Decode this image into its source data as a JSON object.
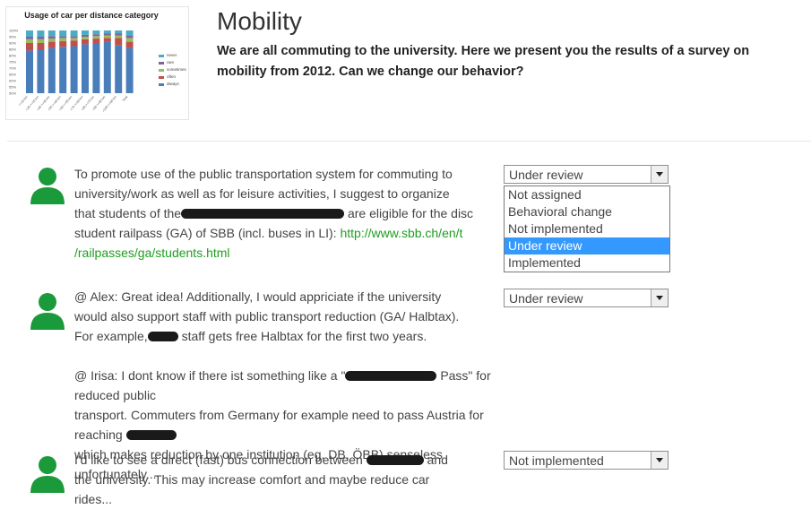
{
  "thumbnail": {
    "title": "Usage of car per distance category",
    "chart_data": {
      "type": "bar",
      "stacked": true,
      "title": "Usage of car per distance category",
      "y_ticks": [
        "100%",
        "95%",
        "90%",
        "85%",
        "80%",
        "75%",
        "70%",
        "65%",
        "60%",
        "55%",
        "50%"
      ],
      "categories": [
        "<=10 km",
        "<30 >=10 km",
        "<40 >=30 km",
        "<50 >=40 km",
        "<60 >=50 km",
        "<70 >=60 km",
        "<80 >=70 km",
        "<90 >=80 km",
        "<100 >=90 km",
        "Total"
      ],
      "series": [
        {
          "name": "always",
          "color": "#4a7ebb",
          "values": [
            68,
            70,
            72,
            74,
            75,
            78,
            80,
            82,
            76,
            72
          ]
        },
        {
          "name": "often",
          "color": "#c0504d",
          "values": [
            12,
            10,
            10,
            9,
            9,
            8,
            7,
            6,
            12,
            10
          ]
        },
        {
          "name": "sometimes",
          "color": "#9bbb59",
          "values": [
            6,
            6,
            5,
            5,
            4,
            4,
            4,
            4,
            4,
            6
          ]
        },
        {
          "name": "rare",
          "color": "#8064a2",
          "values": [
            4,
            4,
            4,
            3,
            3,
            3,
            3,
            3,
            3,
            4
          ]
        },
        {
          "name": "never",
          "color": "#4bacc6",
          "values": [
            10,
            10,
            9,
            9,
            9,
            7,
            6,
            5,
            5,
            8
          ]
        }
      ],
      "legend": [
        "never",
        "rare",
        "sometimes",
        "often",
        "always"
      ],
      "ylim": [
        50,
        100
      ]
    }
  },
  "header": {
    "title": "Mobility",
    "intro_line1": "We are all commuting to the university. Here we present you the results of a survey on",
    "intro_line2": "mobility from 2012. Can we change our behavior?"
  },
  "comments": [
    {
      "line1": "To promote use of the public transportation system for commuting to",
      "line2": "university/work as well as for leisure activities, I suggest to organize",
      "line3_a": "that students of the",
      "line3_b": "are eligible for the disc",
      "line4_a": "student railpass (GA) of SBB (incl. buses in LI):",
      "link_part1": "http://www.sbb.ch/en/t",
      "link_part2": "/railpasses/ga/students.html",
      "status": "Under review"
    },
    {
      "line1": "@ Alex: Great idea! Additionally, I would appriciate if the university",
      "line2": "would also support staff with public transport reduction (GA/ Halbtax).",
      "line3_a": "For example,",
      "line3_b": "staff gets free Halbtax for the first two years.",
      "line4_a": "@ Irisa: I dont know if there ist something like a \"",
      "line4_b": "Pass\" for reduced public",
      "line5": "transport. Commuters from Germany for example need to pass Austria for reaching",
      "line6": "which makes reduction by one institution (eg. DB, ÖBB) senseless unfortunately...",
      "status": "Under review"
    },
    {
      "line1_a": "I'd like to see a direct (fast) bus connection between",
      "line1_b": "and",
      "line2": "the university. This may increase comfort and maybe reduce car",
      "line3": "rides...",
      "status": "Not implemented"
    }
  ],
  "status_options": [
    "Not assigned",
    "Behavioral change",
    "Not implemented",
    "Under review",
    "Implemented"
  ],
  "selected_option": "Under review",
  "colors": {
    "avatar": "#1a9a3a",
    "link": "#1e9e1e",
    "selected_option": "#3399ff"
  },
  "icons": {
    "avatar": "user-silhouette-icon",
    "select_arrow": "chevron-down-icon"
  }
}
